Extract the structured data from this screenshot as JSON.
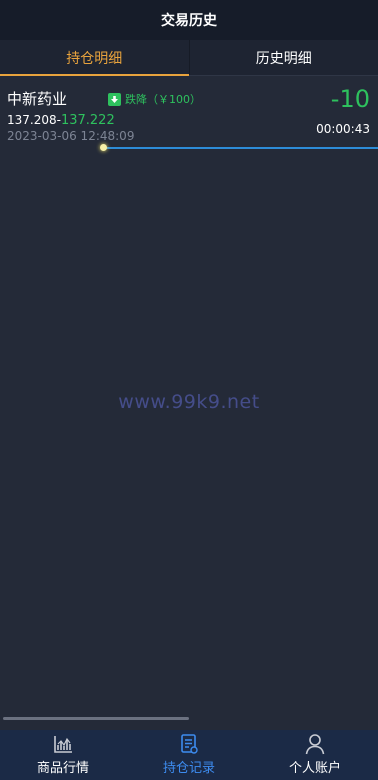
{
  "header": {
    "title": "交易历史"
  },
  "tabs": [
    {
      "label": "持仓明细",
      "active": true
    },
    {
      "label": "历史明细",
      "active": false
    }
  ],
  "record": {
    "name": "中新药业",
    "direction": "跌降（￥100）",
    "open_price": "137.208-",
    "close_price": "137.222",
    "time": "2023-03-06 12:48:09",
    "profit_loss": "-10",
    "duration": "00:00:43"
  },
  "watermark": "www.99k9.net",
  "bottom_nav": [
    {
      "label": "商品行情",
      "icon": "chart-icon",
      "active": false
    },
    {
      "label": "持仓记录",
      "icon": "document-icon",
      "active": true
    },
    {
      "label": "个人账户",
      "icon": "user-icon",
      "active": false
    }
  ],
  "colors": {
    "accent": "#e8a33d",
    "down_green": "#2ec15e",
    "nav_active": "#3d8cf0",
    "background": "#242a38"
  }
}
